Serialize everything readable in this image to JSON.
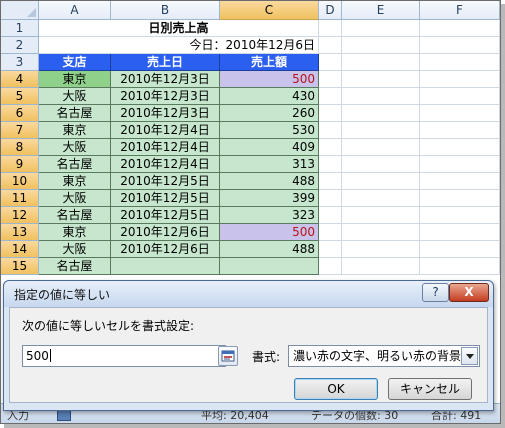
{
  "columns": [
    "A",
    "B",
    "C",
    "D",
    "E",
    "F"
  ],
  "rows": [
    "1",
    "2",
    "3",
    "4",
    "5",
    "6",
    "7",
    "8",
    "9",
    "10",
    "11",
    "12",
    "13",
    "14"
  ],
  "partial_row": "15",
  "sheet": {
    "title": "日別売上高",
    "today": "今日：2010年12月6日",
    "headers": [
      "支店",
      "売上日",
      "売上額"
    ],
    "data": [
      {
        "branch": "東京",
        "date": "2010年12月3日",
        "amount": "500"
      },
      {
        "branch": "大阪",
        "date": "2010年12月3日",
        "amount": "430"
      },
      {
        "branch": "名古屋",
        "date": "2010年12月3日",
        "amount": "260"
      },
      {
        "branch": "東京",
        "date": "2010年12月4日",
        "amount": "530"
      },
      {
        "branch": "大阪",
        "date": "2010年12月4日",
        "amount": "409"
      },
      {
        "branch": "名古屋",
        "date": "2010年12月4日",
        "amount": "313"
      },
      {
        "branch": "東京",
        "date": "2010年12月5日",
        "amount": "488"
      },
      {
        "branch": "大阪",
        "date": "2010年12月5日",
        "amount": "399"
      },
      {
        "branch": "名古屋",
        "date": "2010年12月5日",
        "amount": "323"
      },
      {
        "branch": "東京",
        "date": "2010年12月6日",
        "amount": "500"
      },
      {
        "branch": "大阪",
        "date": "2010年12月6日",
        "amount": "488"
      }
    ],
    "partial_branch": "名古屋"
  },
  "status": {
    "mode": "入力",
    "average": "平均: 20,404",
    "count": "データの個数: 30",
    "sum": "合計: 491"
  },
  "dialog": {
    "title": "指定の値に等しい",
    "help_label": "?",
    "close_label": "X",
    "prompt": "次の値に等しいセルを書式設定:",
    "value": "500",
    "format_label": "書式:",
    "format_value": "濃い赤の文字、明るい赤の背景",
    "ok_label": "OK",
    "cancel_label": "キャンセル"
  },
  "colors": {
    "header_fill": "#2a5ff0",
    "data_fill": "#c6e7cd",
    "highlight_fill": "#c9c3ec",
    "highlight_text": "#b8131a"
  },
  "icons": [
    "collapse-dialog-icon",
    "dropdown-arrow-icon",
    "help-icon",
    "close-icon"
  ]
}
